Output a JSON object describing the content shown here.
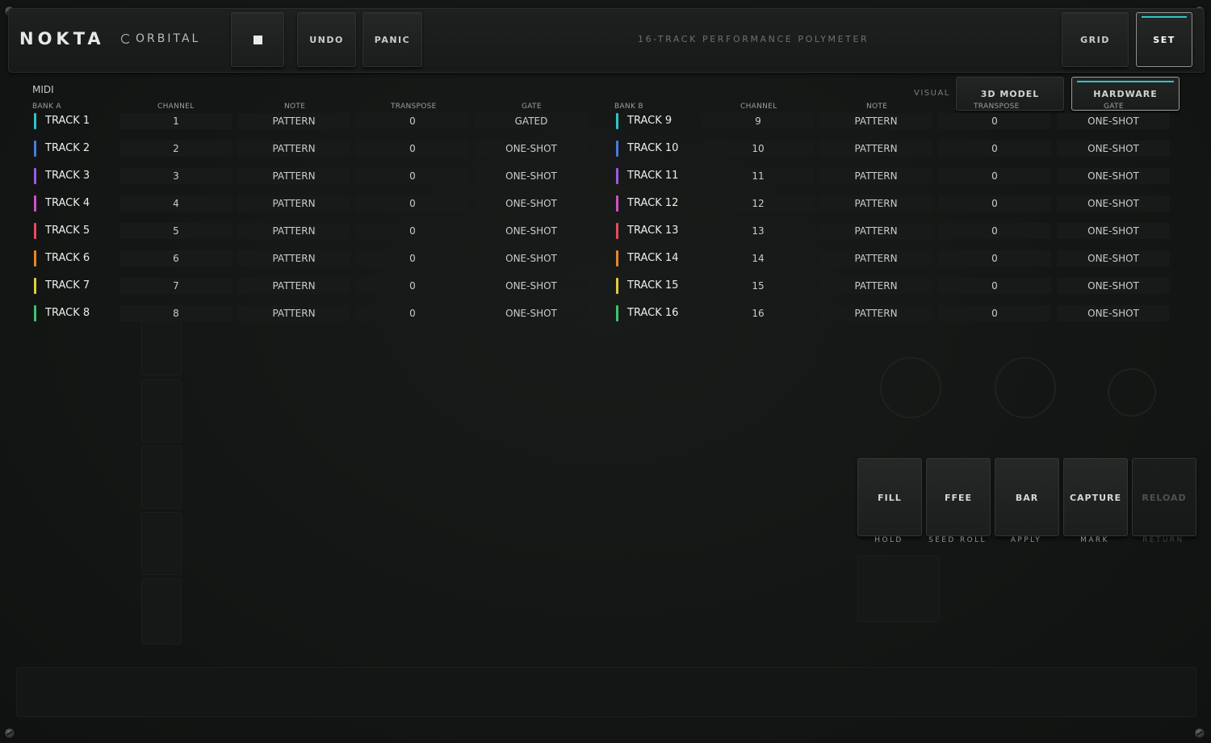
{
  "header": {
    "logo": "NOKTA",
    "product": "ORBITAL",
    "subtitle": "16-TRACK PERFORMANCE POLYMETER",
    "buttons": {
      "undo": "UNDO",
      "panic": "PANIC",
      "grid": "GRID",
      "set": "SET"
    }
  },
  "midi": {
    "title": "MIDI",
    "visual_label": "VISUAL",
    "visual_buttons": {
      "model": "3D MODEL",
      "hardware": "HARDWARE"
    },
    "columns": {
      "bank_a": "BANK A",
      "bank_b": "BANK B",
      "channel": "CHANNEL",
      "note": "NOTE",
      "transpose": "TRANSPOSE",
      "gate": "GATE"
    },
    "bank_a": [
      {
        "name": "TRACK 1",
        "channel": "1",
        "note": "PATTERN",
        "transpose": "0",
        "gate": "GATED",
        "color": "#2ec6c9"
      },
      {
        "name": "TRACK 2",
        "channel": "2",
        "note": "PATTERN",
        "transpose": "0",
        "gate": "ONE-SHOT",
        "color": "#4a7be0"
      },
      {
        "name": "TRACK 3",
        "channel": "3",
        "note": "PATTERN",
        "transpose": "0",
        "gate": "ONE-SHOT",
        "color": "#9a5ce0"
      },
      {
        "name": "TRACK 4",
        "channel": "4",
        "note": "PATTERN",
        "transpose": "0",
        "gate": "ONE-SHOT",
        "color": "#d152c4"
      },
      {
        "name": "TRACK 5",
        "channel": "5",
        "note": "PATTERN",
        "transpose": "0",
        "gate": "ONE-SHOT",
        "color": "#e24d5b"
      },
      {
        "name": "TRACK 6",
        "channel": "6",
        "note": "PATTERN",
        "transpose": "0",
        "gate": "ONE-SHOT",
        "color": "#e7852c"
      },
      {
        "name": "TRACK 7",
        "channel": "7",
        "note": "PATTERN",
        "transpose": "0",
        "gate": "ONE-SHOT",
        "color": "#e3cb3b"
      },
      {
        "name": "TRACK 8",
        "channel": "8",
        "note": "PATTERN",
        "transpose": "0",
        "gate": "ONE-SHOT",
        "color": "#3ec46d"
      }
    ],
    "bank_b": [
      {
        "name": "TRACK 9",
        "channel": "9",
        "note": "PATTERN",
        "transpose": "0",
        "gate": "ONE-SHOT",
        "color": "#2ec6c9"
      },
      {
        "name": "TRACK 10",
        "channel": "10",
        "note": "PATTERN",
        "transpose": "0",
        "gate": "ONE-SHOT",
        "color": "#4a7be0"
      },
      {
        "name": "TRACK 11",
        "channel": "11",
        "note": "PATTERN",
        "transpose": "0",
        "gate": "ONE-SHOT",
        "color": "#9a5ce0"
      },
      {
        "name": "TRACK 12",
        "channel": "12",
        "note": "PATTERN",
        "transpose": "0",
        "gate": "ONE-SHOT",
        "color": "#d152c4"
      },
      {
        "name": "TRACK 13",
        "channel": "13",
        "note": "PATTERN",
        "transpose": "0",
        "gate": "ONE-SHOT",
        "color": "#e24d5b"
      },
      {
        "name": "TRACK 14",
        "channel": "14",
        "note": "PATTERN",
        "transpose": "0",
        "gate": "ONE-SHOT",
        "color": "#e7852c"
      },
      {
        "name": "TRACK 15",
        "channel": "15",
        "note": "PATTERN",
        "transpose": "0",
        "gate": "ONE-SHOT",
        "color": "#e3cb3b"
      },
      {
        "name": "TRACK 16",
        "channel": "16",
        "note": "PATTERN",
        "transpose": "0",
        "gate": "ONE-SHOT",
        "color": "#3ec46d"
      }
    ]
  },
  "performance": {
    "buttons": [
      {
        "label": "FILL",
        "sub": "HOLD",
        "enabled": true
      },
      {
        "label": "FFEE",
        "sub": "SEED  ROLL",
        "enabled": true
      },
      {
        "label": "BAR",
        "sub": "APPLY",
        "enabled": true
      },
      {
        "label": "CAPTURE",
        "sub": "MARK",
        "enabled": true
      },
      {
        "label": "RELOAD",
        "sub": "RETURN",
        "enabled": false
      }
    ]
  },
  "colors": {
    "accent": "#2ec6c9",
    "background": "#151716"
  }
}
